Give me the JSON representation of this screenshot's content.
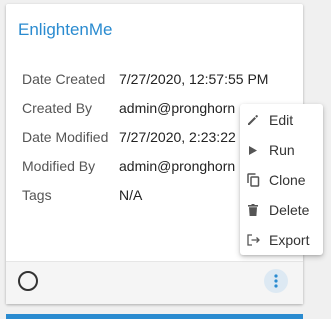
{
  "card": {
    "title": "EnlightenMe",
    "fields": [
      {
        "label": "Date Created",
        "value": "7/27/2020, 12:57:55 PM"
      },
      {
        "label": "Created By",
        "value": "admin@pronghorn"
      },
      {
        "label": "Date Modified",
        "value": "7/27/2020, 2:23:22"
      },
      {
        "label": "Modified By",
        "value": "admin@pronghorn"
      },
      {
        "label": "Tags",
        "value": "N/A"
      }
    ]
  },
  "menu": {
    "items": [
      {
        "label": "Edit",
        "icon": "pencil-icon"
      },
      {
        "label": "Run",
        "icon": "play-icon"
      },
      {
        "label": "Clone",
        "icon": "clone-icon"
      },
      {
        "label": "Delete",
        "icon": "trash-icon"
      },
      {
        "label": "Export",
        "icon": "export-icon"
      }
    ]
  },
  "colors": {
    "title": "#2a8bd0",
    "kebab_bg": "#dde9f3",
    "kebab_dots": "#2a8bd0"
  }
}
